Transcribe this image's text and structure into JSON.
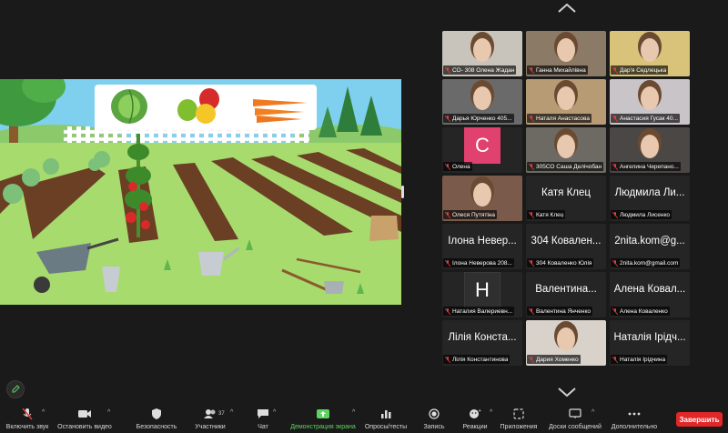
{
  "gallery": [
    {
      "name": "СО- 308 Олена Жадан",
      "type": "video",
      "bg": "#c8c3bb"
    },
    {
      "name": "Ганна Михайлівна",
      "type": "video",
      "bg": "#8a7a66"
    },
    {
      "name": "Дар'я Седлецька",
      "type": "video",
      "bg": "#d9c27a"
    },
    {
      "name": "Дарья Юрченко 405...",
      "type": "video",
      "bg": "#6a6a6a"
    },
    {
      "name": "Наталя Анастасова",
      "type": "video",
      "bg": "#b79b75"
    },
    {
      "name": "Анастасия Гусак 40...",
      "type": "video",
      "bg": "#c9c4c8"
    },
    {
      "name": "Олена",
      "type": "avatar",
      "letter": "С"
    },
    {
      "name": "305СО Саша Делічобан",
      "type": "video",
      "bg": "#6c6a63",
      "active": true
    },
    {
      "name": "Ангелина Черепано...",
      "type": "video",
      "bg": "#4a4745"
    },
    {
      "name": "Олеся Путятіна",
      "type": "video",
      "bg": "#7a5a4a"
    },
    {
      "name": "Катя Клец",
      "type": "text",
      "big": "Катя Клец"
    },
    {
      "name": "Людмила Лисенко",
      "type": "text",
      "big": "Людмила Ли..."
    },
    {
      "name": "Ілона Неверова 208...",
      "type": "text",
      "big": "Ілона Невер..."
    },
    {
      "name": "304 Коваленко Юлія",
      "type": "text",
      "big": "304 Ковален..."
    },
    {
      "name": "2nita.kom@gmail.com",
      "type": "text",
      "big": "2nita.kom@g..."
    },
    {
      "name": "Наталия Валериевн...",
      "type": "avatar",
      "letter": "Н",
      "dark": true
    },
    {
      "name": "Валентина  Янченко",
      "type": "text",
      "big": "Валентина..."
    },
    {
      "name": "Алена Коваленко",
      "type": "text",
      "big": "Алена Ковал..."
    },
    {
      "name": "Лілія Константинова",
      "type": "text",
      "big": "Лілія Конста..."
    },
    {
      "name": "Дария Хоменко",
      "type": "video",
      "bg": "#d8d2cb"
    },
    {
      "name": "Наталія Ірідчина",
      "type": "text",
      "big": "Наталія Ірідч..."
    }
  ],
  "toolbar": {
    "mute": "Включить звук",
    "video": "Остановить видео",
    "security": "Безопасность",
    "participants": "Участники",
    "participants_count": "37",
    "chat": "Чат",
    "share": "Демонстрация экрана",
    "polls": "Опросы/тесты",
    "record": "Запись",
    "reactions": "Реакции",
    "apps": "Приложения",
    "whiteboards": "Доски сообщений",
    "more": "Дополнительно",
    "end": "Завершить"
  },
  "colors": {
    "accent_green": "#5fd35f",
    "end_red": "#e02828",
    "muted_red": "#e03c3c"
  }
}
